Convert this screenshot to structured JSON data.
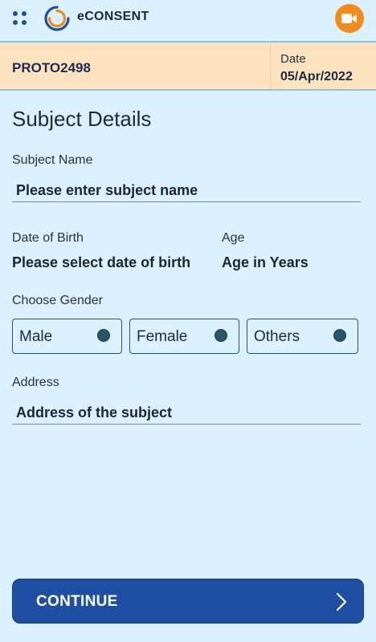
{
  "app": {
    "title": "eCONSENT",
    "icons": {
      "menu": "grid-icon",
      "logo": "econsent-logo",
      "video": "video-camera-icon"
    },
    "colors": {
      "background": "#dbf1fd",
      "band": "#fde3bf",
      "accent": "#1f4fa3",
      "video_button": "#f28a1e"
    }
  },
  "protocol": {
    "id": "PROTO2498",
    "date_label": "Date",
    "date_value": "05/Apr/2022"
  },
  "form": {
    "section_title": "Subject Details",
    "subject_name": {
      "label": "Subject Name",
      "placeholder": "Please enter subject name"
    },
    "dob": {
      "label": "Date of Birth",
      "placeholder": "Please select date of birth"
    },
    "age": {
      "label": "Age",
      "placeholder": "Age in Years"
    },
    "gender": {
      "label": "Choose Gender",
      "options": [
        "Male",
        "Female",
        "Others"
      ]
    },
    "address": {
      "label": "Address",
      "placeholder": "Address of the subject"
    }
  },
  "footer": {
    "continue_label": "CONTINUE",
    "continue_icon": "chevron-right-icon"
  }
}
